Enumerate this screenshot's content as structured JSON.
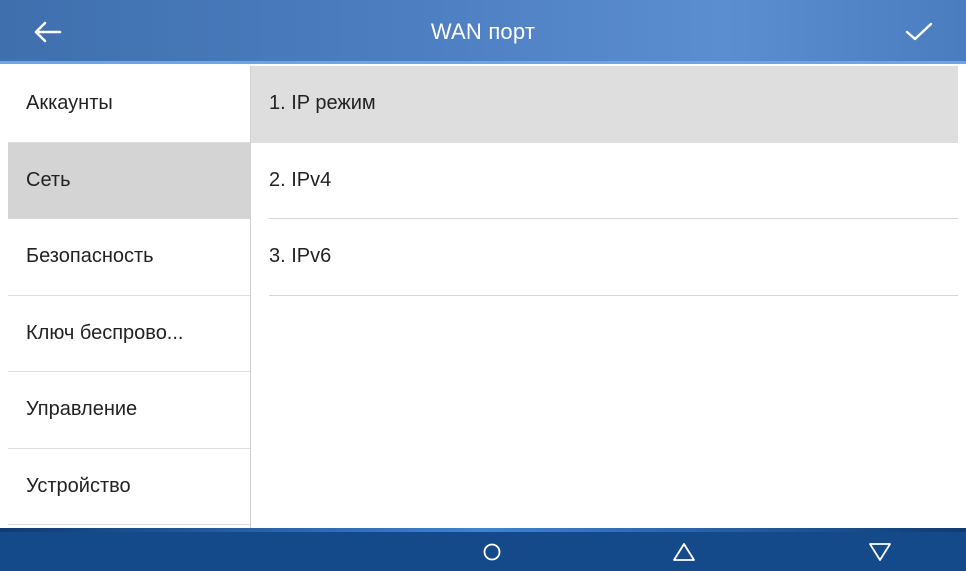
{
  "header": {
    "title": "WAN порт",
    "back_icon": "arrow-left-icon",
    "confirm_icon": "checkmark-icon",
    "gradient_colors": [
      "#3f6fad",
      "#5b8ed0"
    ]
  },
  "sidebar": {
    "items": [
      {
        "label": "Аккаунты",
        "active": false
      },
      {
        "label": "Сеть",
        "active": true
      },
      {
        "label": "Безопасность",
        "active": false
      },
      {
        "label": "Ключ беспрово...",
        "active": false
      },
      {
        "label": "Управление",
        "active": false
      },
      {
        "label": "Устройство",
        "active": false
      }
    ],
    "active_color": "#d4d4d4"
  },
  "content": {
    "items": [
      {
        "label": "1. IP режим"
      },
      {
        "label": "2. IPv4"
      },
      {
        "label": "3. IPv6"
      }
    ]
  },
  "bottom_nav": {
    "background": "#154a8a",
    "buttons": [
      {
        "icon": "circle-icon"
      },
      {
        "icon": "triangle-up-icon"
      },
      {
        "icon": "triangle-down-icon"
      }
    ]
  }
}
